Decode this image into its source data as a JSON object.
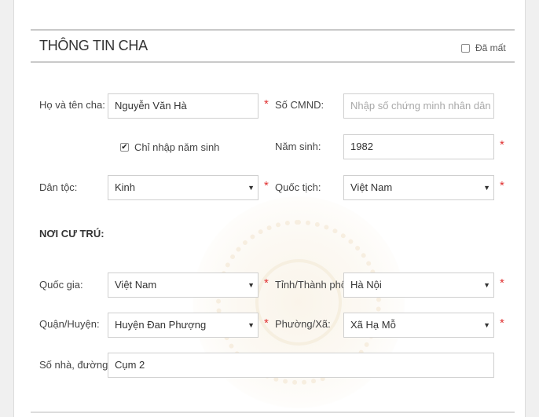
{
  "section": {
    "title": "THÔNG TIN CHA",
    "lost_label": "Đã mất",
    "lost_checked": false
  },
  "form": {
    "father_name": {
      "label": "Họ và tên cha:",
      "value": "Nguyễn Văn Hà"
    },
    "id_number": {
      "label": "Số CMND:",
      "placeholder": "Nhập số chứng minh nhân dân"
    },
    "year_only": {
      "label": "Chỉ nhập năm sinh",
      "checked": true,
      "check_glyph": "✔"
    },
    "birth_year": {
      "label": "Năm sinh:",
      "value": "1982"
    },
    "ethnicity": {
      "label": "Dân tộc:",
      "value": "Kinh"
    },
    "nationality": {
      "label": "Quốc tịch:",
      "value": "Việt Nam"
    }
  },
  "residence": {
    "heading": "NƠI CƯ TRÚ:",
    "country": {
      "label": "Quốc gia:",
      "value": "Việt Nam"
    },
    "province": {
      "label": "Tỉnh/Thành phố:",
      "value": "Hà Nội"
    },
    "district": {
      "label": "Quận/Huyện:",
      "value": "Huyện Đan Phượng"
    },
    "ward": {
      "label": "Phường/Xã:",
      "value": "Xã Hạ Mỗ"
    },
    "street": {
      "label": "Số nhà, đường:",
      "value": "Cụm 2"
    }
  },
  "ui": {
    "required_mark": "*",
    "dropdown_arrow": "▼",
    "required_color": "#e03131"
  }
}
